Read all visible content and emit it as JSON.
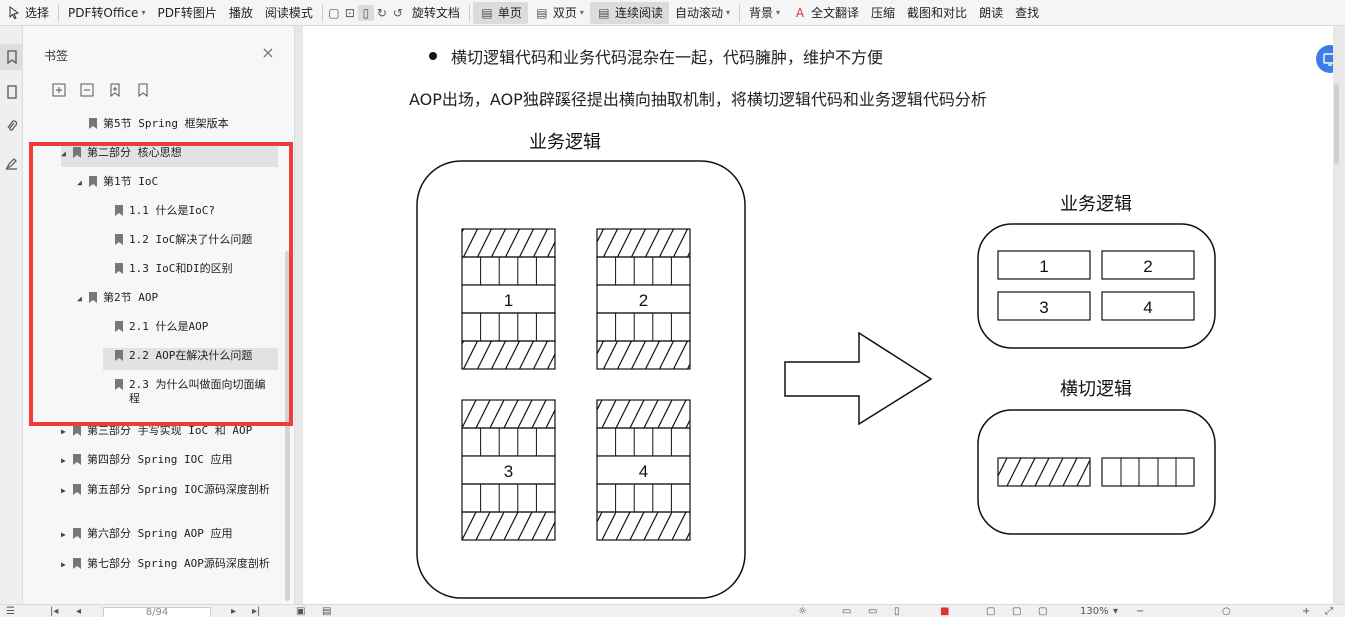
{
  "toolbar": {
    "items": [
      {
        "label": "选择",
        "icon": "cursor-icon"
      },
      {
        "label": "PDF转Office",
        "caret": true
      },
      {
        "label": "PDF转图片"
      },
      {
        "label": "播放"
      },
      {
        "label": "阅读模式"
      },
      {
        "label": "旋转文档"
      },
      {
        "label": "单页",
        "active": true
      },
      {
        "label": "双页",
        "caret": true
      },
      {
        "label": "连续阅读",
        "active": true
      },
      {
        "label": "自动滚动",
        "caret": true
      },
      {
        "label": "背景",
        "caret": true
      },
      {
        "label": "全文翻译"
      },
      {
        "label": "压缩"
      },
      {
        "label": "截图和对比"
      },
      {
        "label": "朗读"
      },
      {
        "label": "查找"
      }
    ]
  },
  "panel": {
    "title": "书签",
    "close_label": "×"
  },
  "bookmarks": [
    {
      "label": "第5节 Spring 框架版本",
      "level": 2,
      "expand": "none"
    },
    {
      "label": "第二部分 核心思想",
      "level": 1,
      "expand": "open",
      "selected": true
    },
    {
      "label": "第1节 IoC",
      "level": 2,
      "expand": "open"
    },
    {
      "label": "1.1 什么是IoC?",
      "level": 3,
      "expand": "none"
    },
    {
      "label": "1.2 IoC解决了什么问题",
      "level": 3,
      "expand": "none"
    },
    {
      "label": "1.3 IoC和DI的区别",
      "level": 3,
      "expand": "none"
    },
    {
      "label": "第2节 AOP",
      "level": 2,
      "expand": "open"
    },
    {
      "label": "2.1 什么是AOP",
      "level": 3,
      "expand": "none"
    },
    {
      "label": "2.2 AOP在解决什么问题",
      "level": 3,
      "expand": "none",
      "selected": true
    },
    {
      "label": "2.3 为什么叫做面向切面编程",
      "level": 3,
      "expand": "none"
    },
    {
      "label": "第三部分 手写实现 IoC 和 AOP",
      "level": 1,
      "expand": "closed"
    },
    {
      "label": "第四部分 Spring IOC 应用",
      "level": 1,
      "expand": "closed"
    },
    {
      "label": "第五部分 Spring IOC源码深度剖析",
      "level": 1,
      "expand": "closed"
    },
    {
      "label": "第六部分 Spring AOP 应用",
      "level": 1,
      "expand": "closed"
    },
    {
      "label": "第七部分 Spring AOP源码深度剖析",
      "level": 1,
      "expand": "closed"
    }
  ],
  "doc": {
    "bullet": "横切逻辑代码和业务代码混杂在一起，代码臃肿，维护不方便",
    "paragraph": "AOP出场，AOP独辟蹊径提出横向抽取机制，将横切逻辑代码和业务逻辑代码分析"
  },
  "diagram": {
    "left_title": "业务逻辑",
    "left_blocks": [
      "1",
      "2",
      "3",
      "4"
    ],
    "right_top_title": "业务逻辑",
    "right_top_blocks": [
      "1",
      "2",
      "3",
      "4"
    ],
    "right_bottom_title": "横切逻辑"
  },
  "statusbar": {
    "page_value": "8/94",
    "zoom": "130%"
  },
  "colors": {
    "highlight": "#ee3b3b",
    "accent": "#3d7de6"
  }
}
